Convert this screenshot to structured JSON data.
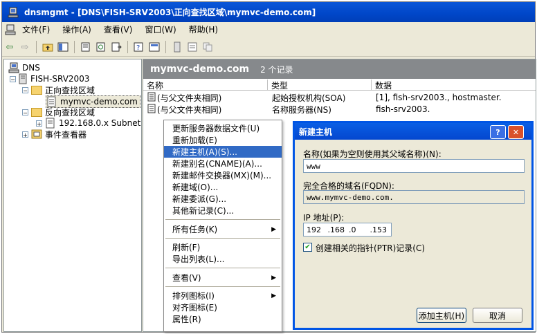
{
  "window": {
    "title": "dnsmgmt - [DNS\\FISH-SRV2003\\正向查找区域\\mymvc-demo.com]"
  },
  "menubar": [
    "文件(F)",
    "操作(A)",
    "查看(V)",
    "窗口(W)",
    "帮助(H)"
  ],
  "toolbar": {
    "icons": [
      "back-arrow-icon",
      "forward-arrow-icon",
      "up-folder-icon",
      "show-tree-icon",
      "properties-icon",
      "refresh-icon",
      "export-list-icon",
      "help-icon",
      "console-icon",
      "server-icon",
      "list-icon",
      "copy-icon"
    ]
  },
  "tree": {
    "root": "DNS",
    "server": "FISH-SRV2003",
    "forward_zones": "正向查找区域",
    "zone": "mymvc-demo.com",
    "reverse_zones": "反向查找区域",
    "reverse_subnet": "192.168.0.x Subnet",
    "event_viewer": "事件查看器"
  },
  "list": {
    "zone_title": "mymvc-demo.com",
    "record_count": "2 个记录",
    "columns": [
      "名称",
      "类型",
      "数据"
    ],
    "rows": [
      {
        "name": "(与父文件夹相同)",
        "type": "起始授权机构(SOA)",
        "data": "[1], fish-srv2003., hostmaster."
      },
      {
        "name": "(与父文件夹相同)",
        "type": "名称服务器(NS)",
        "data": "fish-srv2003."
      }
    ]
  },
  "context_menu": {
    "items": [
      "更新服务器数据文件(U)",
      "重新加载(E)",
      "新建主机(A)(S)...",
      "新建别名(CNAME)(A)...",
      "新建邮件交换器(MX)(M)...",
      "新建域(O)...",
      "新建委派(G)...",
      "其他新记录(C)...",
      "所有任务(K)",
      "刷新(F)",
      "导出列表(L)...",
      "查看(V)",
      "排列图标(I)",
      "对齐图标(E)",
      "属性(R)"
    ]
  },
  "dialog": {
    "title": "新建主机",
    "help_button": "?",
    "close_button": "✕",
    "name_label": "名称(如果为空则使用其父域名称)(N):",
    "name_value": "www",
    "fqdn_label": "完全合格的域名(FQDN):",
    "fqdn_value": "www.mymvc-demo.com.",
    "ip_label": "IP 地址(P):",
    "ip_octets": [
      "192",
      ".168",
      ".0",
      ".153"
    ],
    "ptr_checkbox_label": "创建相关的指针(PTR)记录(C)",
    "ptr_checked": true,
    "add_button": "添加主机(H)",
    "cancel_button": "取消"
  }
}
